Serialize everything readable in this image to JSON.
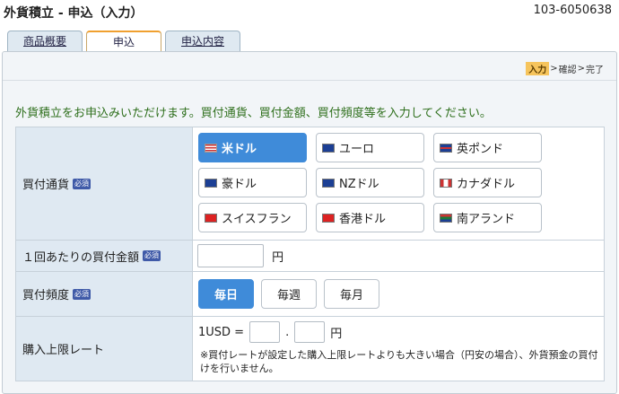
{
  "header": {
    "title": "外貨積立 - 申込（入力）",
    "account": "103-6050638"
  },
  "tabs": [
    {
      "label": "商品概要"
    },
    {
      "label": "申込"
    },
    {
      "label": "申込内容"
    }
  ],
  "steps": {
    "current": "入力",
    "next1": "確認",
    "next2": "完了",
    "sep": ">"
  },
  "intro": "外貨積立をお申込みいただけます。買付通貨、買付金額、買付頻度等を入力してください。",
  "form": {
    "required_badge": "必須",
    "currency": {
      "label": "買付通貨",
      "selected": "米ドル",
      "options": [
        {
          "label": "米ドル",
          "flag": "us-flag"
        },
        {
          "label": "ユーロ",
          "flag": "eu-flag"
        },
        {
          "label": "英ポンド",
          "flag": "uk-flag"
        },
        {
          "label": "豪ドル",
          "flag": "au-flag"
        },
        {
          "label": "NZドル",
          "flag": "nz-flag"
        },
        {
          "label": "カナダドル",
          "flag": "ca-flag"
        },
        {
          "label": "スイスフラン",
          "flag": "ch-flag"
        },
        {
          "label": "香港ドル",
          "flag": "hk-flag"
        },
        {
          "label": "南アランド",
          "flag": "za-flag"
        }
      ]
    },
    "amount": {
      "label": "１回あたりの買付金額",
      "value": "",
      "unit": "円"
    },
    "frequency": {
      "label": "買付頻度",
      "selected": "毎日",
      "options": [
        {
          "label": "毎日"
        },
        {
          "label": "毎週"
        },
        {
          "label": "毎月"
        }
      ]
    },
    "rate_limit": {
      "label": "購入上限レート",
      "prefix": "1USD =",
      "dot": ".",
      "unit": "円",
      "int_value": "",
      "dec_value": "",
      "note": "※買付レートが設定した購入上限レートよりも大きい場合（円安の場合）、外貨預金の買付けを行いません。"
    }
  }
}
